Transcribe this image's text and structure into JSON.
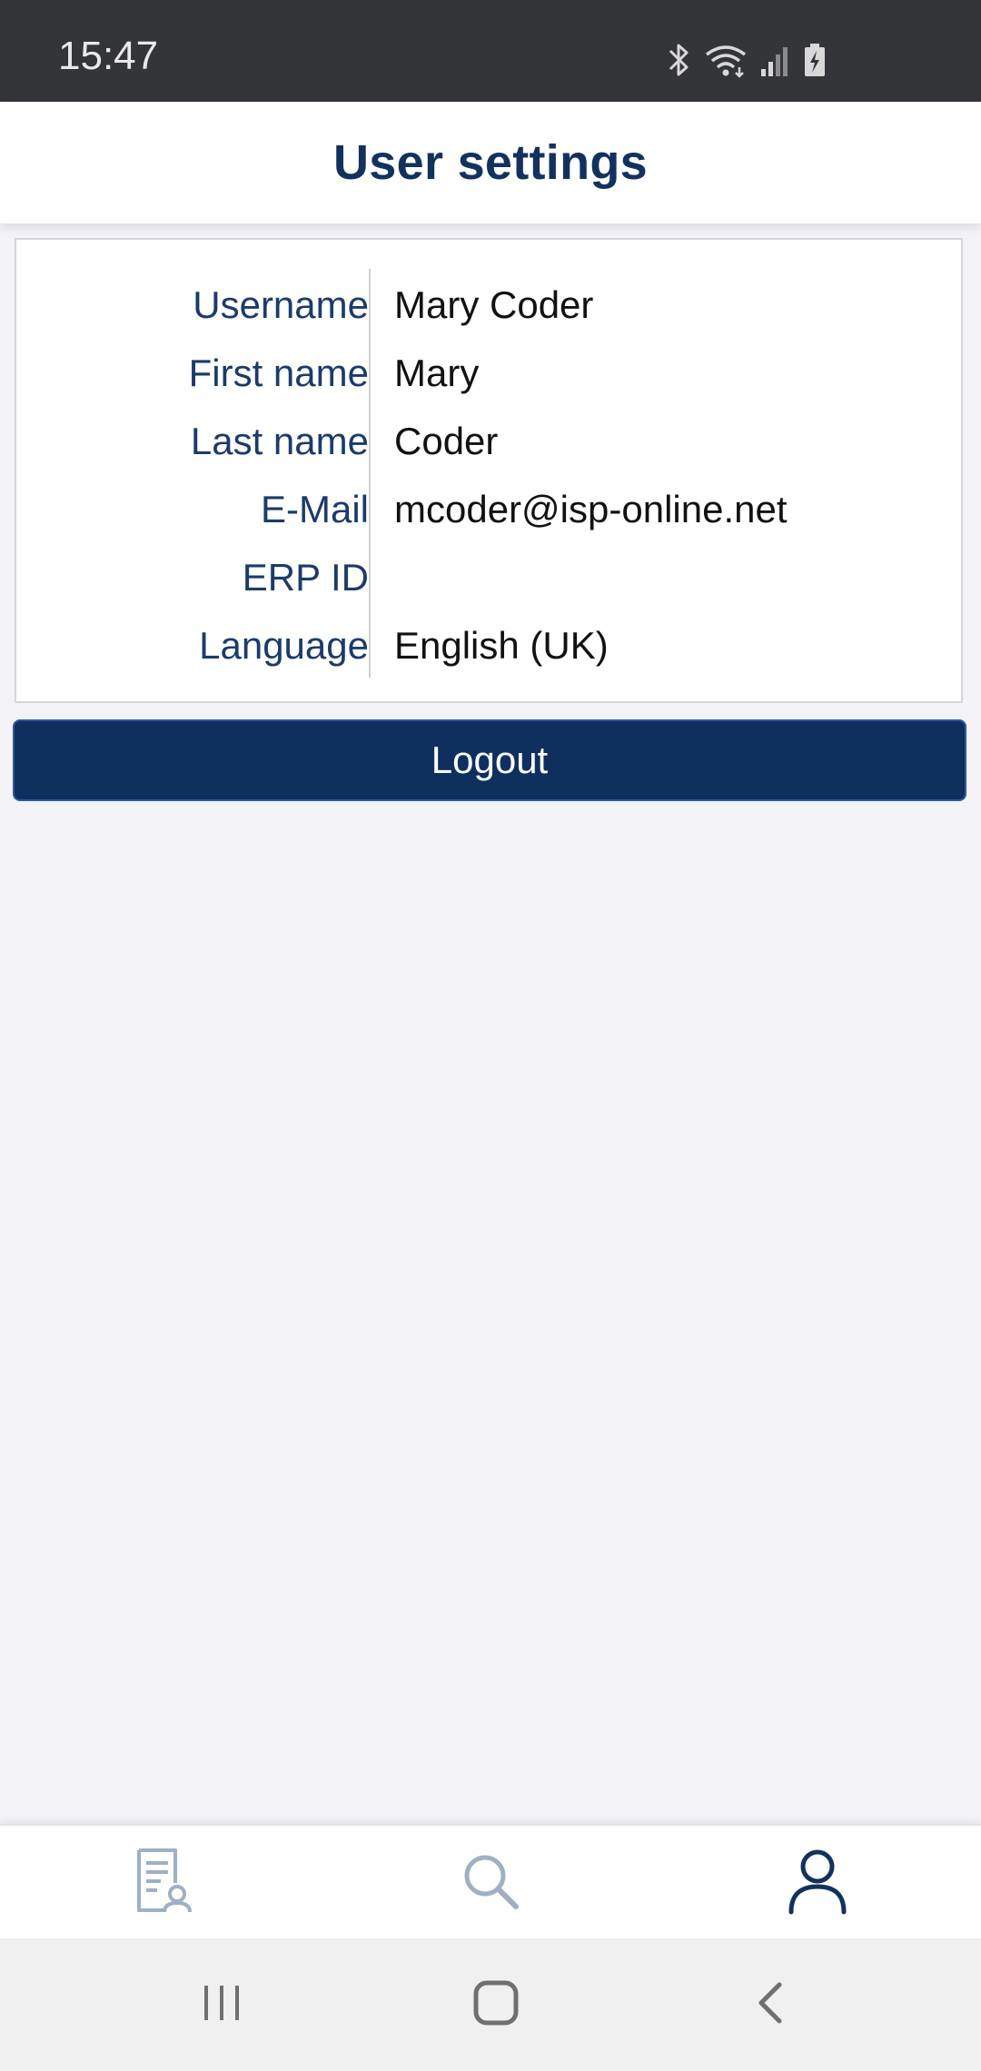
{
  "status_bar": {
    "time": "15:47",
    "icons": [
      "bluetooth-icon",
      "wifi-icon",
      "signal-icon",
      "battery-charging-icon"
    ]
  },
  "header": {
    "title": "User settings"
  },
  "user_info": {
    "rows": [
      {
        "label": "Username",
        "value": "Mary Coder"
      },
      {
        "label": "First name",
        "value": "Mary"
      },
      {
        "label": "Last name",
        "value": "Coder"
      },
      {
        "label": "E-Mail",
        "value": "mcoder@isp-online.net"
      },
      {
        "label": "ERP ID",
        "value": ""
      },
      {
        "label": "Language",
        "value": "English (UK)"
      }
    ]
  },
  "logout": {
    "label": "Logout"
  },
  "bottom_nav": {
    "items": [
      {
        "icon": "document-user-icon",
        "active": false
      },
      {
        "icon": "search-icon",
        "active": false
      },
      {
        "icon": "user-icon",
        "active": true
      }
    ]
  },
  "system_nav": {
    "items": [
      "recent-apps-icon",
      "home-icon",
      "back-icon"
    ]
  },
  "colors": {
    "primary": "#12325e",
    "button": "#0f2f5f",
    "inactive_icon": "#9eb0c4",
    "background": "#f2f2f7"
  }
}
